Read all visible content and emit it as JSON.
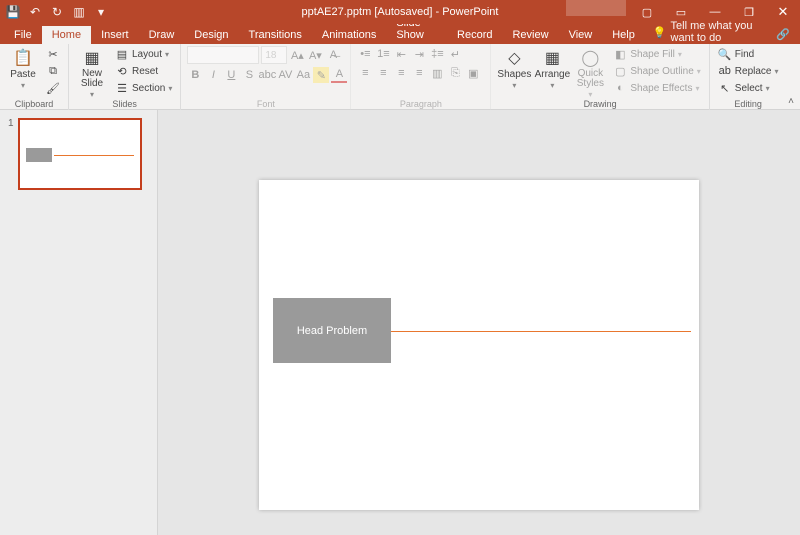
{
  "titlebar": {
    "title": "pptAE27.pptm [Autosaved] - PowerPoint",
    "save_icon": "💾",
    "undo_icon": "↶",
    "redo_icon": "↻",
    "startfrom_icon": "▥",
    "minimize": "—",
    "restore": "❐",
    "close": "✕",
    "ribbon_display": "▭",
    "present": "▢"
  },
  "tabs": {
    "file": "File",
    "home": "Home",
    "insert": "Insert",
    "draw": "Draw",
    "design": "Design",
    "transitions": "Transitions",
    "animations": "Animations",
    "slideshow": "Slide Show",
    "record": "Record",
    "review": "Review",
    "view": "View",
    "help": "Help",
    "tellme": "Tell me what you want to do",
    "share": "🔗"
  },
  "ribbon": {
    "clipboard": {
      "label": "Clipboard",
      "paste": "Paste",
      "cut": "✂",
      "copy": "⧉",
      "painter": "🖌"
    },
    "slides": {
      "label": "Slides",
      "newslide": "New\nSlide",
      "layout": "Layout",
      "reset": "Reset",
      "section": "Section"
    },
    "font": {
      "label": "Font",
      "name_placeholder": " ",
      "size": "18"
    },
    "paragraph": {
      "label": "Paragraph"
    },
    "drawing": {
      "label": "Drawing",
      "shapes": "Shapes",
      "arrange": "Arrange",
      "quick": "Quick\nStyles",
      "fill": "Shape Fill",
      "outline": "Shape Outline",
      "effects": "Shape Effects"
    },
    "editing": {
      "label": "Editing",
      "find": "Find",
      "replace": "Replace",
      "select": "Select"
    }
  },
  "thumb": {
    "number": "1"
  },
  "slide": {
    "box_text": "Head Problem"
  }
}
